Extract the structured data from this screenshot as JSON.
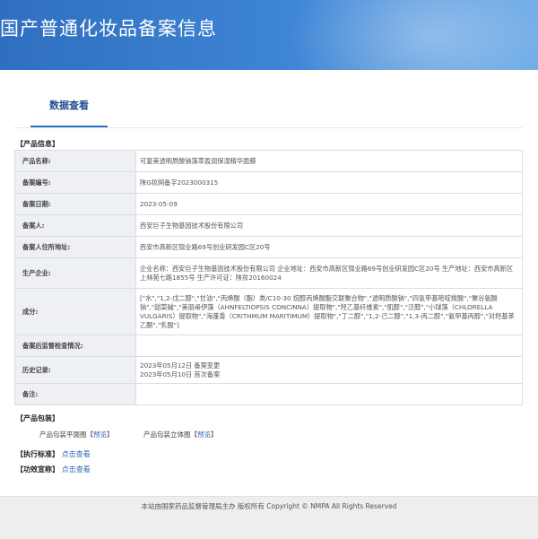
{
  "header": {
    "title": "国产普通化妆品备案信息"
  },
  "tab": {
    "label": "数据查看"
  },
  "product_info": {
    "section_title": "【产品信息】",
    "rows": [
      {
        "label": "产品名称:",
        "value": "可复美透明质酸钠藻萃盈润保湿精华面膜"
      },
      {
        "label": "备案编号:",
        "value": "陕G妆网备字2023000315"
      },
      {
        "label": "备案日期:",
        "value": "2023-05-09"
      },
      {
        "label": "备案人:",
        "value": "西安巨子生物基因技术股份有限公司"
      },
      {
        "label": "备案人住所地址:",
        "value": "西安市高新区锦业路69号创业研发园C区20号"
      },
      {
        "label": "生产企业:",
        "value": "企业名称：西安巨子生物基因技术股份有限公司 企业地址：西安市高新区锦业路69号创业研发园C区20号 生产地址：西安市高新区上林苑七路1855号 生产许可证：陕妆20160024"
      },
      {
        "label": "成分:",
        "value": "[\"水\",\"1,2-戊二醇\",\"甘油\",\"丙烯酸（酯）类/C10-30 烷醇丙烯酸酯交联聚合物\",\"透明质酸钠\",\"四氢甲基嘧啶羧酸\",\"聚谷氨酸钠\",\"甜菜碱\",\"美丽帚伊藻（AHNFELTIOPSIS CONCINNA）提取物\",\"羟乙基纤维素\",\"肌醇\",\"泛醇\",\"小球藻（CHLORELLA VULGARIS）提取物\",\"海蓬香（CRITHMUM MARITIMUM）提取物\",\"丁二醇\",\"1,2-己二醇\",\"1,3-丙二醇\",\"氨甲基丙醇\",\"对羟基苯乙酮\",\"乳酸\"]"
      },
      {
        "label": "备案后监督检查情况:",
        "value": ""
      },
      {
        "label": "历史记录:",
        "value_lines": [
          "2023年05月12日 备案变更",
          "2023年05月10日 首次备案"
        ]
      },
      {
        "label": "备注:",
        "value": ""
      }
    ]
  },
  "packaging": {
    "section_title": "【产品包装】",
    "items": [
      {
        "label": "产品包装平面图",
        "link": "预览"
      },
      {
        "label": "产品包装立体图",
        "link": "预览"
      }
    ]
  },
  "standard": {
    "section_title": "【执行标准】",
    "link": "点击查看"
  },
  "claims": {
    "section_title": "【功效宣称】",
    "link": "点击查看"
  },
  "footer": {
    "text": "本站由国家药品监督管理局主办 版权所有 Copyright © NMPA All Rights Reserved"
  }
}
